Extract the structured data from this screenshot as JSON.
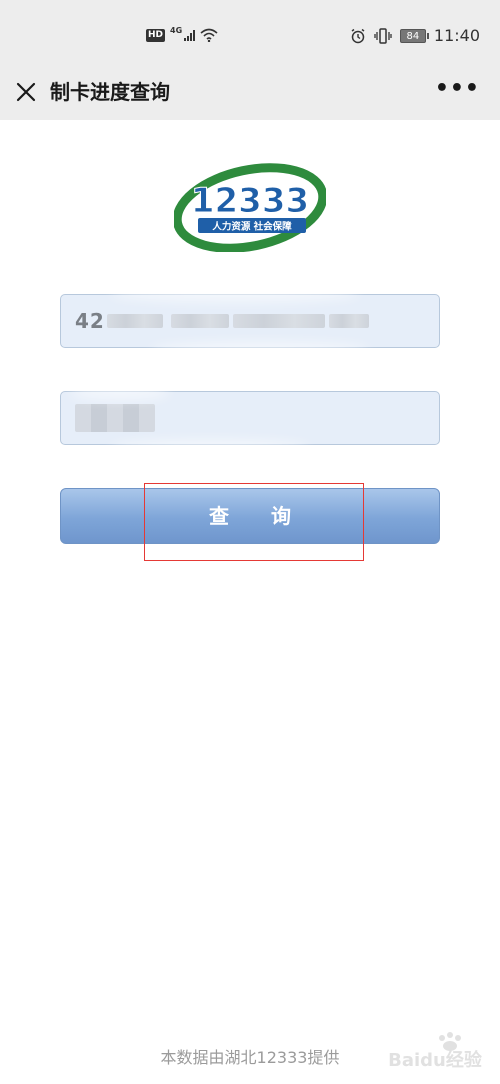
{
  "status_bar": {
    "hd_badge": "HD",
    "network": "4G",
    "battery": "84",
    "time": "11:40"
  },
  "header": {
    "title": "制卡进度查询",
    "more_label": "•••"
  },
  "logo": {
    "number": "12333",
    "tagline": "人力资源 社会保障",
    "colors": {
      "ring": "#2e8b3d",
      "text": "#1f5fa8"
    }
  },
  "form": {
    "id_field_value": "42",
    "query_button_label": "查询"
  },
  "footer": {
    "note": "本数据由湖北12333提供"
  },
  "watermark": {
    "text": "Baidu经验"
  }
}
